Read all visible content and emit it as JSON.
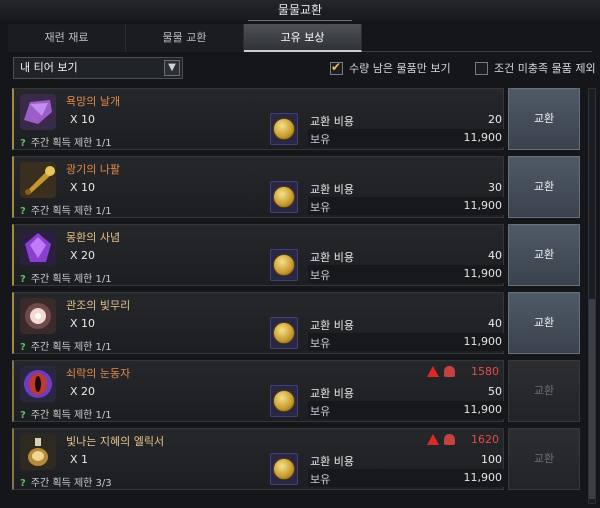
{
  "window": {
    "title": "물물교환"
  },
  "tabs": [
    {
      "label": "재련 재료"
    },
    {
      "label": "물물 교환"
    },
    {
      "label": "고유 보상"
    }
  ],
  "filters": {
    "tier_select": "내 티어 보기",
    "only_affordable": {
      "label": "수량 남은 물품만 보기",
      "checked": true
    },
    "exclude_unmet": {
      "label": "조건 미충족 물품 제외",
      "checked": false
    }
  },
  "currency_icon": "gold-coin-icon",
  "cost_label": "교환 비용",
  "owned_label": "보유",
  "exchange_label": "교환",
  "items": [
    {
      "name": "욕망의 날개",
      "qty": "X 10",
      "limit": "주간 획득 제한 1/1",
      "cost": "20",
      "owned": "11,900",
      "icon": "purple-wing-icon",
      "enabled": true,
      "requirement": ""
    },
    {
      "name": "광기의 나팔",
      "qty": "X 10",
      "limit": "주간 획득 제한 1/1",
      "cost": "30",
      "owned": "11,900",
      "icon": "golden-horn-icon",
      "enabled": true,
      "requirement": ""
    },
    {
      "name": "몽환의 사념",
      "qty": "X 20",
      "limit": "주간 획득 제한 1/1",
      "cost": "40",
      "owned": "11,900",
      "icon": "purple-crystal-icon",
      "enabled": true,
      "requirement": ""
    },
    {
      "name": "관조의 빛무리",
      "qty": "X 10",
      "limit": "주간 획득 제한 1/1",
      "cost": "40",
      "owned": "11,900",
      "icon": "light-orb-icon",
      "enabled": true,
      "requirement": ""
    },
    {
      "name": "쇠락의 눈동자",
      "qty": "X 20",
      "limit": "주간 획득 제한 1/1",
      "cost": "50",
      "owned": "11,900",
      "icon": "eye-icon",
      "enabled": false,
      "requirement": "1580"
    },
    {
      "name": "빛나는 지혜의 엘릭서",
      "qty": "X 1",
      "limit": "주간 획득 제한 3/3",
      "cost": "100",
      "owned": "11,900",
      "icon": "elixir-icon",
      "enabled": false,
      "requirement": "1620"
    }
  ],
  "colors": {
    "accent": "#a4894a",
    "item_name": "#e0894a",
    "warning": "#e24b4b",
    "limit_marker": "#5fc05f"
  }
}
